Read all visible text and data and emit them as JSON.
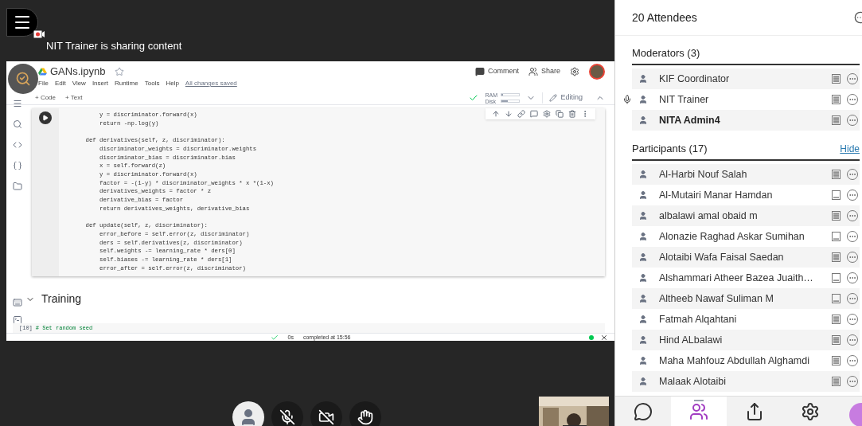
{
  "share_banner": {
    "text": "NIT Trainer is sharing content"
  },
  "notebook": {
    "title": "GANs.ipynb",
    "menu": [
      "File",
      "Edit",
      "View",
      "Insert",
      "Runtime",
      "Tools",
      "Help"
    ],
    "save_status": "All changes saved",
    "header_actions": [
      "Comment",
      "Share"
    ],
    "add_buttons": [
      "+ Code",
      "+ Text"
    ],
    "resources": [
      {
        "label": "RAM",
        "level": 0.05
      },
      {
        "label": "Disk",
        "level": 0.35
      }
    ],
    "mode": "Editing",
    "code_cell": {
      "blocks": [
        [
          "        y = discriminator.forward(x)",
          "        return -np.log(y)"
        ],
        [
          "    def derivatives(self, z, discriminator):",
          "        discriminator_weights = discriminator.weights",
          "        discriminator_bias = discriminator.bias",
          "        x = self.forward(z)",
          "        y = discriminator.forward(x)",
          "        factor = -(1-y) * discriminator_weights * x *(1-x)",
          "        derivatives_weights = factor * z",
          "        derivative_bias = factor",
          "        return derivatives_weights, derivative_bias"
        ],
        [
          "    def update(self, z, discriminator):",
          "        error_before = self.error(z, discriminator)",
          "        ders = self.derivatives(z, discriminator)",
          "        self.weights -= learning_rate * ders[0]",
          "        self.biases -= learning_rate * ders[1]",
          "        error_after = self.error(z, discriminator)"
        ]
      ]
    },
    "section_heading": "Training",
    "next_cell": {
      "count": "[10]",
      "code": "# Set random seed"
    },
    "status_bar": {
      "duration": "0s",
      "text": "completed at 15:56"
    }
  },
  "call_controls": [
    {
      "kind": "avatar"
    },
    {
      "kind": "microphone",
      "on": false
    },
    {
      "kind": "camera",
      "on": false
    },
    {
      "kind": "hand"
    }
  ],
  "attendees": {
    "title": "20 Attendees",
    "groups": [
      {
        "title": "Moderators (3)",
        "members": [
          {
            "name": "KIF Coordinator",
            "speaking": false,
            "bold": false,
            "kind": "full"
          },
          {
            "name": "NIT Trainer",
            "speaking": true,
            "bold": false,
            "kind": "full"
          },
          {
            "name": "NITA Admin4",
            "speaking": false,
            "bold": true,
            "kind": "full"
          }
        ]
      },
      {
        "title": "Participants (17)",
        "action": "Hide",
        "members": [
          {
            "name": "Al-Harbi Nouf Salah",
            "speaking": false,
            "bold": false,
            "kind": "full"
          },
          {
            "name": "Al-Mutairi Manar Hamdan",
            "speaking": false,
            "bold": false,
            "kind": "partial"
          },
          {
            "name": "albalawi amal obaid m",
            "speaking": false,
            "bold": false,
            "kind": "full"
          },
          {
            "name": "Alonazie Raghad Askar Sumihan",
            "speaking": false,
            "bold": false,
            "kind": "partial"
          },
          {
            "name": "Alotaibi Wafa Faisal Saedan",
            "speaking": false,
            "bold": false,
            "kind": "full"
          },
          {
            "name": "Alshammari Atheer Bazea Juaith…",
            "speaking": false,
            "bold": false,
            "kind": "partial"
          },
          {
            "name": "Altheeb Nawaf Suliman M",
            "speaking": false,
            "bold": false,
            "kind": "partial"
          },
          {
            "name": "Fatmah Alqahtani",
            "speaking": false,
            "bold": false,
            "kind": "full"
          },
          {
            "name": "Hind ALbalawi",
            "speaking": false,
            "bold": false,
            "kind": "full"
          },
          {
            "name": "Maha Mahfouz Abdullah Alghamdi",
            "speaking": false,
            "bold": false,
            "kind": "full"
          },
          {
            "name": "Malaak Alotaibi",
            "speaking": false,
            "bold": false,
            "kind": "full"
          }
        ]
      }
    ]
  },
  "panel_tabs": [
    {
      "kind": "chat",
      "selected": false
    },
    {
      "kind": "attendees",
      "selected": true
    },
    {
      "kind": "share",
      "selected": false
    },
    {
      "kind": "settings",
      "selected": false
    }
  ]
}
